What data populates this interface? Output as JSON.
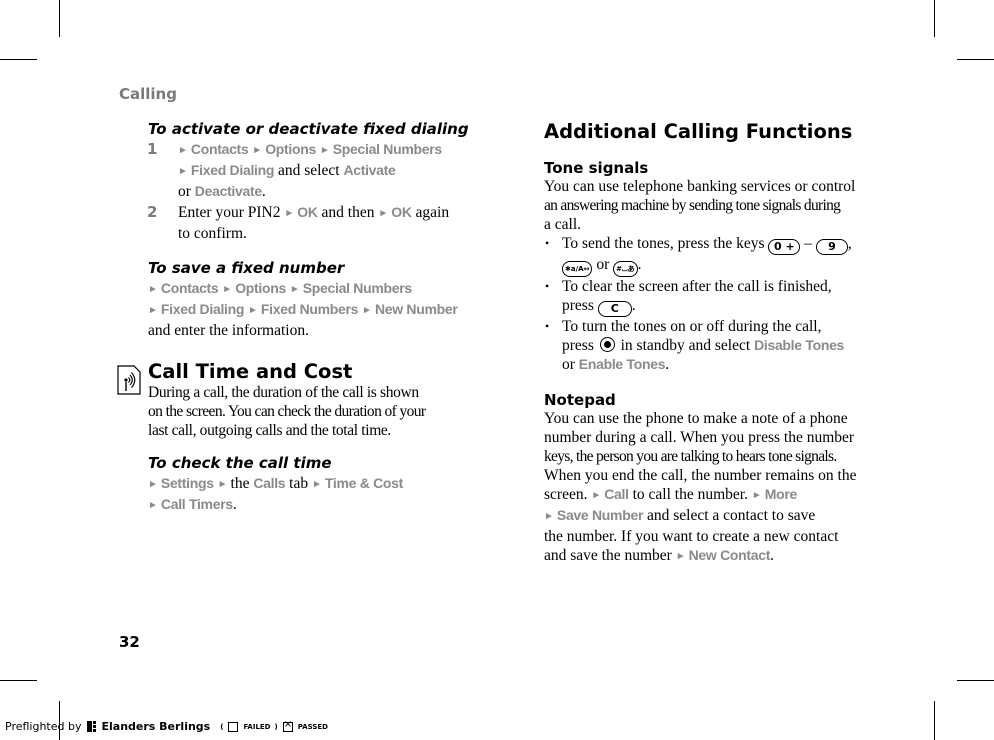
{
  "running_head": "Calling",
  "page_number": "32",
  "left": {
    "fixed_dialing": {
      "title": "To activate or deactivate fixed dialing",
      "steps": [
        {
          "num": "1",
          "path1": [
            "Contacts",
            "Options",
            "Special Numbers"
          ],
          "path2": [
            "Fixed Dialing"
          ],
          "text_and_select": "and select",
          "option_a": "Activate",
          "or": "or",
          "option_b": "Deactivate",
          "end": "."
        },
        {
          "num": "2",
          "text1": "Enter your PIN2",
          "ok1": "OK",
          "text2": "and then",
          "ok2": "OK",
          "text3": "again",
          "text4": "to confirm."
        }
      ]
    },
    "save_number": {
      "title": "To save a fixed number",
      "path1": [
        "Contacts",
        "Options",
        "Special Numbers"
      ],
      "path2": [
        "Fixed Dialing",
        "Fixed Numbers",
        "New Number"
      ],
      "text": "and enter the information."
    },
    "call_time": {
      "icon": "network-service-icon",
      "title": "Call Time and Cost",
      "lines": [
        "During a call, the duration of the call is shown",
        "on the screen. You can check the duration of your",
        "last call, outgoing calls and the total time."
      ]
    },
    "check_call_time": {
      "title": "To check the call time",
      "settings": "Settings",
      "the": "the",
      "calls": "Calls",
      "tab": "tab",
      "time_cost": "Time & Cost",
      "call_timers": "Call Timers",
      "end": "."
    }
  },
  "right": {
    "title": "Additional Calling Functions",
    "tone_signals": {
      "title": "Tone signals",
      "lines": [
        "You can use telephone banking services or control",
        "an answering machine by sending tone signals during",
        "a call."
      ],
      "bullets": {
        "b1_text": "To send the tones, press the keys",
        "key_0": "0 +",
        "dash": "–",
        "key_9": "9",
        "comma": ",",
        "key_star": "✱a/A↔",
        "or": "or",
        "key_hash": "#⌴あ",
        "period": ".",
        "b2_line1": "To clear the screen after the call is finished,",
        "b2_press": "press",
        "key_c": "C",
        "b3_line1": "To turn the tones on or off during the call,",
        "b3_press": "press",
        "b3_mid": "in standby and select",
        "disable": "Disable Tones",
        "b3_or": "or",
        "enable": "Enable Tones"
      }
    },
    "notepad": {
      "title": "Notepad",
      "lines": [
        "You can use the phone to make a note of a phone",
        "number during a call. When you press the number",
        "keys, the person you are talking to hears tone signals.",
        "When you end the call, the number remains on the"
      ],
      "screen": "screen.",
      "call": "Call",
      "call_text": "to call the number.",
      "more": "More",
      "save_number": "Save Number",
      "save_text": "and select a contact to save",
      "line_a": "the number. If you want to create a new contact",
      "line_b": "and save the number",
      "new_contact": "New Contact",
      "end": "."
    }
  },
  "preflight": {
    "prefix": "Preflighted by",
    "brand": "Elanders Berlings",
    "open": "(",
    "failed": "FAILED",
    "close": ")",
    "passed": "PASSED"
  },
  "colors": {
    "menu_gray": "#8a8a8a",
    "head_gray": "#7a7a7a"
  }
}
